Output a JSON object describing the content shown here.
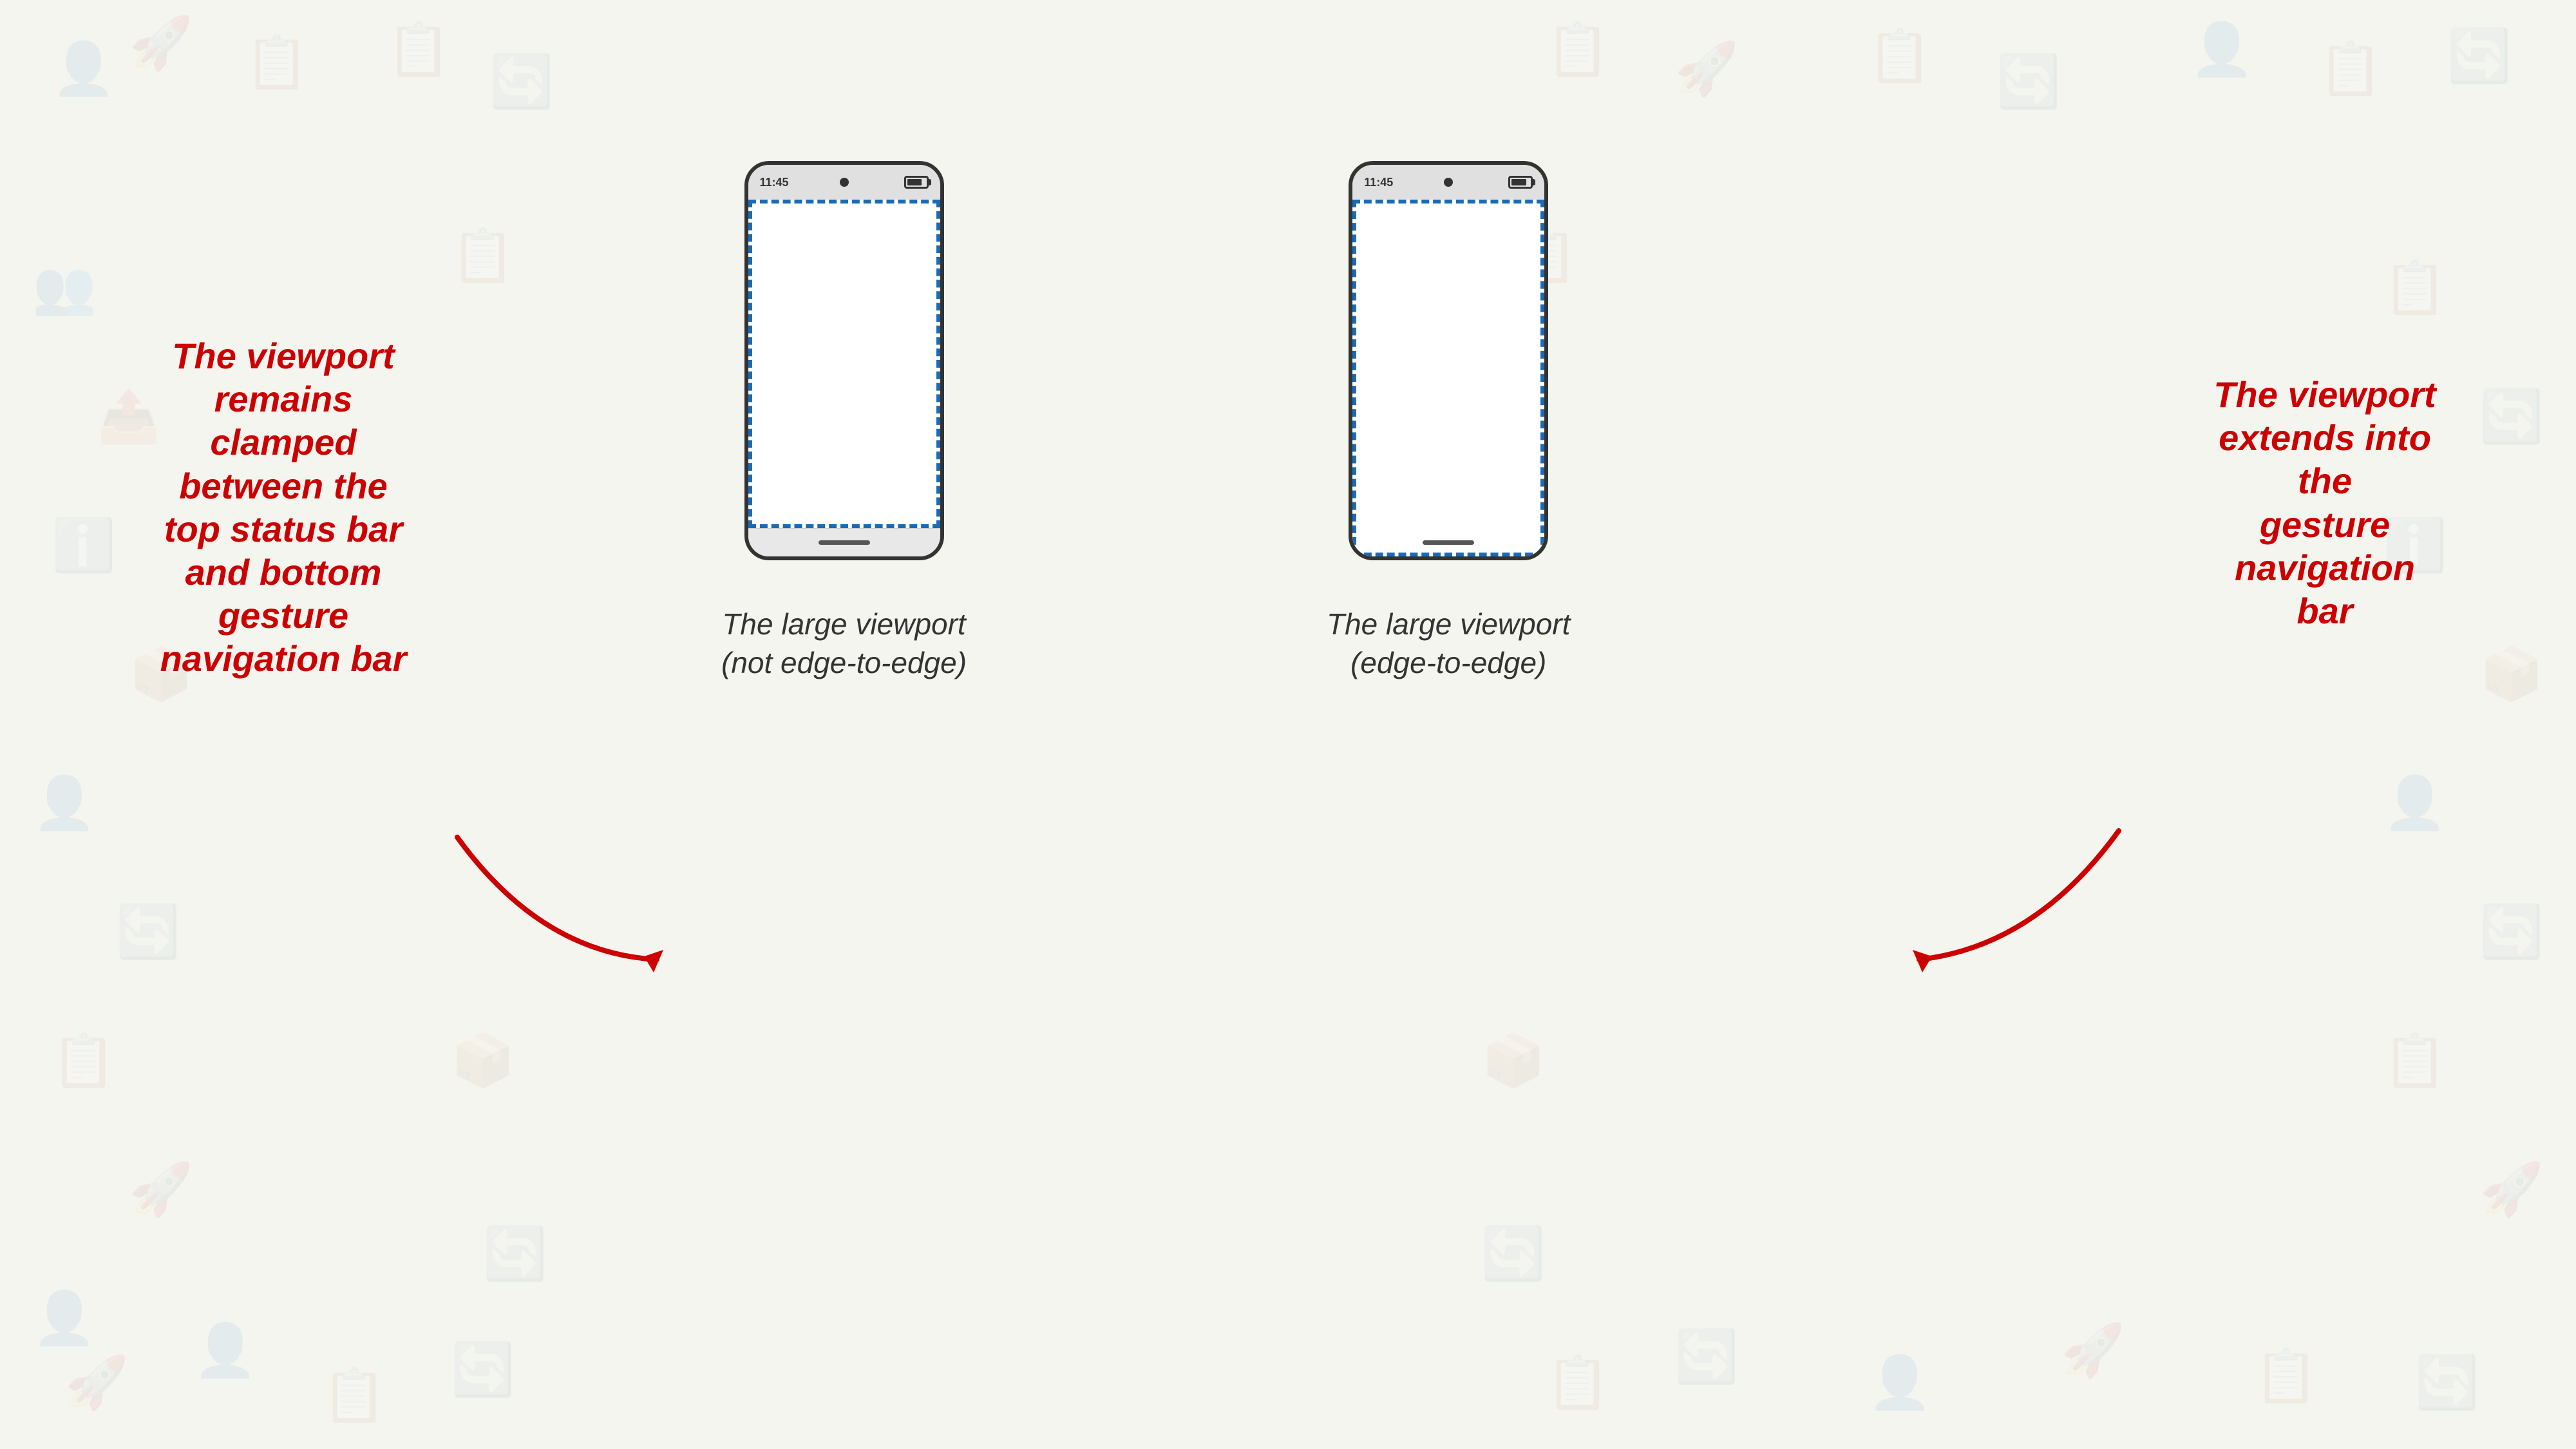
{
  "background": {
    "color": "#f5f5f0"
  },
  "phones": [
    {
      "id": "not-edge",
      "status_time": "11:45",
      "label_line1": "The large viewport",
      "label_line2": "(not edge-to-edge)",
      "type": "not-edge-to-edge"
    },
    {
      "id": "edge",
      "status_time": "11:45",
      "label_line1": "The large viewport",
      "label_line2": "(edge-to-edge)",
      "type": "edge-to-edge"
    }
  ],
  "annotations": {
    "left": {
      "line1": "The viewport",
      "line2": "remains",
      "line3": "clamped",
      "line4": "between the",
      "line5": "top status bar",
      "line6": "and bottom",
      "line7": "gesture",
      "line8": "navigation bar"
    },
    "right": {
      "line1": "The viewport",
      "line2": "extends into the",
      "line3": "gesture navigation",
      "line4": "bar"
    }
  },
  "colors": {
    "annotation_red": "#cc0000",
    "phone_border": "#333333",
    "dashed_border": "#1a6bb5",
    "status_bar_bg": "#e0e0e0",
    "nav_bar_bg": "#f0f0f0"
  }
}
